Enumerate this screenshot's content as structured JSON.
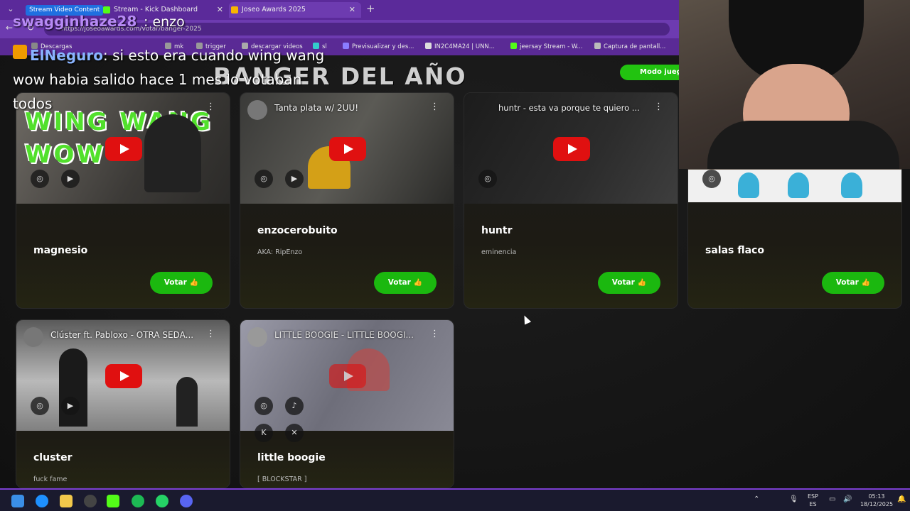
{
  "browser": {
    "tab_group_label": "Stream Video Content",
    "tabs": [
      {
        "label": "Stream - Kick Dashboard",
        "active": false
      },
      {
        "label": "Joseo Awards 2025",
        "active": true
      }
    ],
    "url": "https://joseoawards.com/votar/banger-2025",
    "bookmarks": [
      "Descargas",
      "mk",
      "trigger",
      "descargar videos",
      "sl",
      "Previsualizar y des...",
      "IN2C4MA24 | UNN...",
      "jeersay Stream - W...",
      "Captura de pantall..."
    ]
  },
  "page": {
    "title": "BANGER DEL AÑO",
    "mode_button": "Modo juego",
    "vote_label": "Votar",
    "cards": [
      {
        "video_title": "",
        "name": "magnesio",
        "aka": "",
        "socials": [
          "instagram",
          "youtube"
        ]
      },
      {
        "video_title": "Tanta plata w/ 2UU!",
        "name": "enzocerobuito",
        "aka": "AKA: RipEnzo",
        "socials": [
          "instagram",
          "youtube"
        ]
      },
      {
        "video_title": "huntr - esta va porque te quiero ...",
        "name": "huntr",
        "aka": "eminencia",
        "socials": [
          "instagram"
        ]
      },
      {
        "video_title": "",
        "name": "salas flaco",
        "aka": "",
        "socials": [
          "instagram"
        ]
      },
      {
        "video_title": "Clúster ft. Pabloxo - OTRA SEDA...",
        "name": "cluster",
        "aka": "fuck fame",
        "socials": [
          "instagram",
          "youtube"
        ]
      },
      {
        "video_title": "LITTLE BOOGIE - LITTLE BOOGI...",
        "name": "little boogie",
        "aka": "[ BLOCKSTAR ]",
        "socials": [
          "instagram",
          "tiktok",
          "kick",
          "x"
        ]
      }
    ],
    "thumb_text": "WING WANG WOW"
  },
  "chat": {
    "top_user": "swagginhaze28",
    "top_message": ": enzo",
    "user": "ElNeguro",
    "message": ": si esto era cuando wing wang wow habia salido hace 1 mes lo votaban todos"
  },
  "taskbar": {
    "lang_top": "ESP",
    "lang_bottom": "ES",
    "time": "05:13",
    "date": "18/12/2025"
  },
  "colors": {
    "vote_green": "#1bb80f",
    "tab_purple": "#5b2a9a",
    "youtube_red": "#e01010"
  }
}
